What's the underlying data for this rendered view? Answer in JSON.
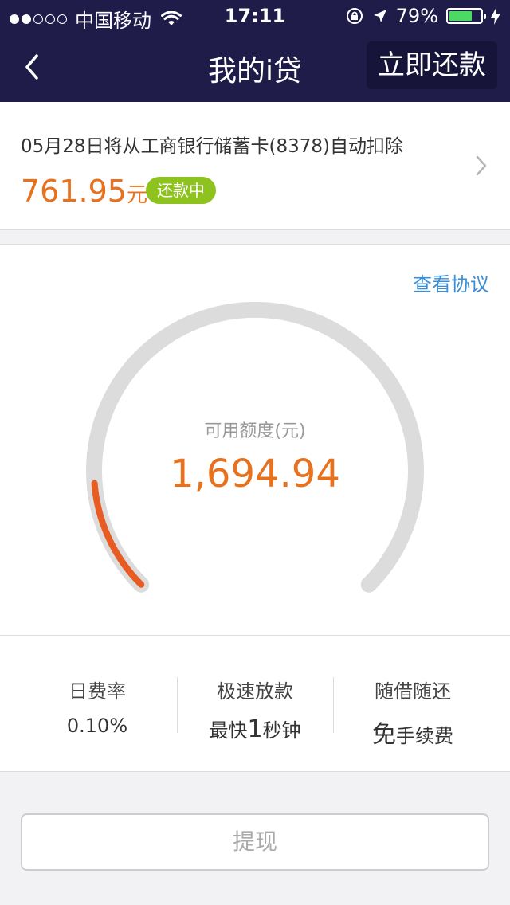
{
  "status_bar": {
    "carrier": "中国移动",
    "time": "17:11",
    "battery_percent": "79%",
    "signal_bars_filled": 2,
    "signal_bars_total": 5,
    "battery_level": 0.79
  },
  "nav": {
    "title": "我的i贷",
    "repay_label": "立即还款",
    "back_icon": "chevron-left-icon"
  },
  "deduction": {
    "note": "05月28日将从工商银行储蓄卡(8378)自动扣除",
    "amount": "761.95",
    "unit": "元",
    "status_tag": "还款中",
    "tag_color": "#8dc21f",
    "amount_color": "#e8711e"
  },
  "credit": {
    "agreement_link": "查看协议",
    "available_label": "可用额度(元)",
    "available_amount": "1,694.94",
    "usage_fraction": 0.15,
    "accent_color": "#e85c23",
    "track_color": "#dcdcdc"
  },
  "features": [
    {
      "title": "日费率",
      "value_prefix": "",
      "value_emphasis": "",
      "value_suffix": "0.10%"
    },
    {
      "title": "极速放款",
      "value_prefix": "最快",
      "value_emphasis": "1",
      "value_suffix": "秒钟"
    },
    {
      "title": "随借随还",
      "value_prefix": "",
      "value_emphasis": "免",
      "value_suffix": "手续费"
    }
  ],
  "withdraw_label": "提现"
}
